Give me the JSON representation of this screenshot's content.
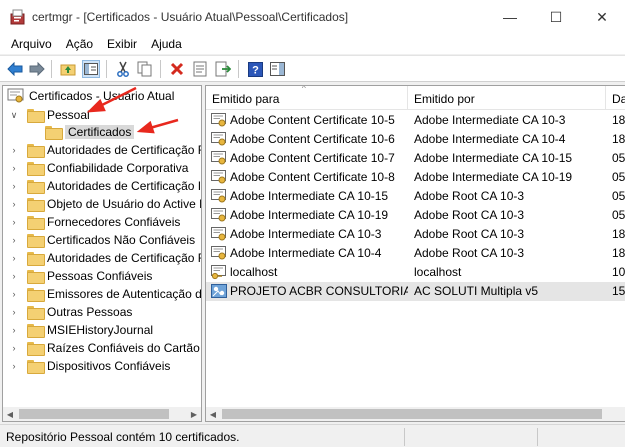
{
  "window": {
    "title": "certmgr - [Certificados - Usuário Atual\\Pessoal\\Certificados]",
    "minimize": "—",
    "maximize": "☐",
    "close": "✕"
  },
  "menu": [
    {
      "label": "Arquivo"
    },
    {
      "label": "Ação"
    },
    {
      "label": "Exibir"
    },
    {
      "label": "Ajuda"
    }
  ],
  "toolbar": {
    "icons": [
      "back-icon",
      "forward-icon",
      "up-folder-icon",
      "show-hide-tree-icon",
      "cut-icon",
      "copy-icon",
      "delete-icon",
      "properties-icon",
      "export-icon",
      "help-icon",
      "pane-icon"
    ]
  },
  "tree": {
    "root": "Certificados - Usuário Atual",
    "pessoal": "Pessoal",
    "certificados": "Certificados",
    "items": [
      {
        "label": "Autoridades de Certificação Raiz Confiáveis"
      },
      {
        "label": "Confiabilidade Corporativa"
      },
      {
        "label": "Autoridades de Certificação Intermediárias"
      },
      {
        "label": "Objeto de Usuário do Active Directory"
      },
      {
        "label": "Fornecedores Confiáveis"
      },
      {
        "label": "Certificados Não Confiáveis"
      },
      {
        "label": "Autoridades de Certificação Raiz de Terceiros"
      },
      {
        "label": "Pessoas Confiáveis"
      },
      {
        "label": "Emissores de Autenticação de Cliente"
      },
      {
        "label": "Outras Pessoas"
      },
      {
        "label": "MSIEHistoryJournal"
      },
      {
        "label": "Raízes Confiáveis do Cartão Inteligente"
      },
      {
        "label": "Dispositivos Confiáveis"
      }
    ]
  },
  "list": {
    "columns": [
      {
        "label": "Emitido para"
      },
      {
        "label": "Emitido por"
      },
      {
        "label": "Data de Validade"
      }
    ],
    "rows": [
      {
        "issued_to": "Adobe Content Certificate 10-5",
        "issued_by": "Adobe Intermediate CA 10-3",
        "expiry": "18",
        "icon": "certificate-icon"
      },
      {
        "issued_to": "Adobe Content Certificate 10-6",
        "issued_by": "Adobe Intermediate CA 10-4",
        "expiry": "18",
        "icon": "certificate-icon"
      },
      {
        "issued_to": "Adobe Content Certificate 10-7",
        "issued_by": "Adobe Intermediate CA 10-15",
        "expiry": "05",
        "icon": "certificate-icon"
      },
      {
        "issued_to": "Adobe Content Certificate 10-8",
        "issued_by": "Adobe Intermediate CA 10-19",
        "expiry": "05",
        "icon": "certificate-icon"
      },
      {
        "issued_to": "Adobe Intermediate CA 10-15",
        "issued_by": "Adobe Root CA 10-3",
        "expiry": "05",
        "icon": "certificate-icon"
      },
      {
        "issued_to": "Adobe Intermediate CA 10-19",
        "issued_by": "Adobe Root CA 10-3",
        "expiry": "05",
        "icon": "certificate-icon"
      },
      {
        "issued_to": "Adobe Intermediate CA 10-3",
        "issued_by": "Adobe Root CA 10-3",
        "expiry": "18",
        "icon": "certificate-icon"
      },
      {
        "issued_to": "Adobe Intermediate CA 10-4",
        "issued_by": "Adobe Root CA 10-3",
        "expiry": "18",
        "icon": "certificate-icon"
      },
      {
        "issued_to": "localhost",
        "issued_by": "localhost",
        "expiry": "10",
        "icon": "certificate-key-icon"
      },
      {
        "issued_to": "PROJETO ACBR CONSULTORIA ...",
        "issued_by": "AC SOLUTI Multipla v5",
        "expiry": "15",
        "icon": "certificate-smartcard-icon"
      }
    ]
  },
  "status": {
    "text": "Repositório Pessoal contém 10 certificados."
  },
  "colors": {
    "annotation_arrow": "#e8281e",
    "selection": "#d9d9d9",
    "folder": "#f4d073"
  }
}
